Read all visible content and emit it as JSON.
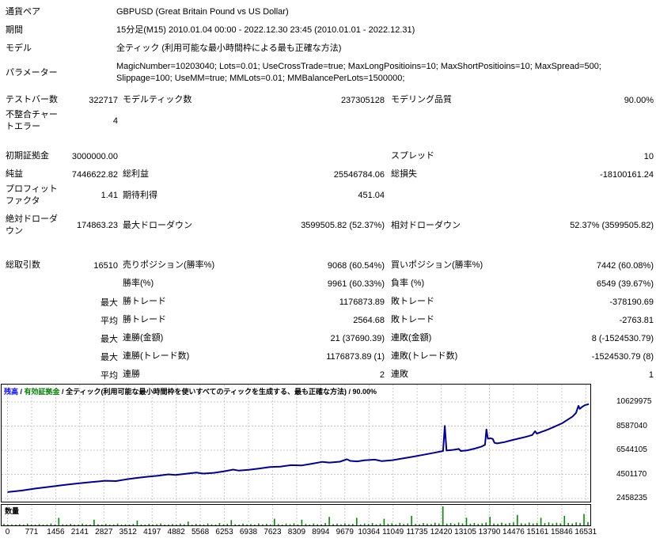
{
  "report": {
    "info_rows": [
      {
        "name": "currency-pair",
        "label": "通貨ペア",
        "value": "GBPUSD (Great Britain Pound vs US Dollar)"
      },
      {
        "name": "period",
        "label": "期間",
        "value": "15分足(M15) 2010.01.04 00:00 - 2022.12.30 23:45 (2010.01.01 - 2022.12.31)"
      },
      {
        "name": "model",
        "label": "モデル",
        "value": "全ティック (利用可能な最小時間枠による最も正確な方法)"
      },
      {
        "name": "parameters",
        "label": "パラメーター",
        "value": "MagicNumber=10203040; Lots=0.01; UseCrossTrade=true; MaxLongPositioins=10; MaxShortPositioins=10; MaxSpread=500; Slippage=100; UseMM=true; MMLots=0.01; MMBalancePerLots=1500000;"
      }
    ],
    "stats_rows": [
      {
        "name": "bars-ticks-quality",
        "gap": "",
        "cells": [
          "テストバー数",
          "322717",
          "モデルティック数",
          "237305128",
          "モデリング品質",
          "90.00%"
        ]
      },
      {
        "name": "mismatched-chart-errors",
        "gap": "",
        "cells": [
          "不整合チャートエラー",
          "4",
          "",
          "",
          "",
          ""
        ]
      },
      {
        "name": "initial-deposit-spread",
        "gap": "lg",
        "cells": [
          "初期証拠金",
          "3000000.00",
          "",
          "",
          "スプレッド",
          "10"
        ]
      },
      {
        "name": "net-profit",
        "gap": "",
        "cells": [
          "純益",
          "7446622.82",
          "総利益",
          "25546784.06",
          "総損失",
          "-18100161.24"
        ]
      },
      {
        "name": "profit-factor",
        "gap": "",
        "cells": [
          "プロフィットファクタ",
          "1.41",
          "期待利得",
          "451.04",
          "",
          ""
        ]
      },
      {
        "name": "drawdown",
        "gap": "sm",
        "cells": [
          "絶対ドローダウン",
          "174863.23",
          "最大ドローダウン",
          "3599505.82 (52.37%)",
          "相対ドローダウン",
          "52.37% (3599505.82)"
        ]
      },
      {
        "name": "total-trades",
        "gap": "md",
        "cells": [
          "総取引数",
          "16510",
          "売りポジション(勝率%)",
          "9068 (60.54%)",
          "買いポジション(勝率%)",
          "7442 (60.08%)"
        ]
      },
      {
        "name": "win-loss-rate",
        "gap": "",
        "cells": [
          "",
          "",
          "勝率(%)",
          "9961 (60.33%)",
          "負率 (%)",
          "6549 (39.67%)"
        ]
      },
      {
        "name": "largest-trades",
        "gap": "",
        "cells": [
          "",
          "最大",
          "勝トレード",
          "1176873.89",
          "敗トレード",
          "-378190.69"
        ]
      },
      {
        "name": "average-trades",
        "gap": "",
        "cells": [
          "",
          "平均",
          "勝トレード",
          "2564.68",
          "敗トレード",
          "-2763.81"
        ]
      },
      {
        "name": "max-consecutive-money",
        "gap": "",
        "cells": [
          "",
          "最大",
          "連勝(金額)",
          "21 (37690.39)",
          "連敗(金額)",
          "8 (-1524530.79)"
        ]
      },
      {
        "name": "max-consecutive-trades",
        "gap": "",
        "cells": [
          "",
          "最大",
          "連勝(トレード数)",
          "1176873.89 (1)",
          "連敗(トレード数)",
          "-1524530.79 (8)"
        ]
      },
      {
        "name": "avg-consecutive",
        "gap": "",
        "cells": [
          "",
          "平均",
          "連勝",
          "2",
          "連敗",
          "1"
        ]
      }
    ]
  },
  "chart_header": {
    "balance_label": "残高",
    "equity_label": "有効証拠金",
    "model_note": "全ティック(利用可能な最小時間枠を使いすべてのティックを生成する、最も正確な方法)",
    "quality": "90.00%",
    "separator": " / "
  },
  "volume_label": "数量",
  "chart_data": {
    "type": "line",
    "title": "残高 / 有効証拠金",
    "x_ticks": [
      0,
      771,
      1456,
      2141,
      2827,
      3512,
      4197,
      4882,
      5568,
      6253,
      6938,
      7623,
      8309,
      8994,
      9679,
      10364,
      11049,
      11735,
      12420,
      13105,
      13790,
      14476,
      15161,
      15846,
      16531
    ],
    "y_ticks": [
      10629975,
      8587040,
      6544105,
      4501170,
      2458235
    ],
    "x_range": [
      0,
      16760
    ],
    "y_range": [
      2458235,
      10629975
    ],
    "grid": true,
    "line_color": "#000096",
    "volume_color": "#008C00",
    "grid_color": "#C8C8C8",
    "balance_label_color": "#0000FF",
    "equity_label_color": "#008000",
    "series": [
      {
        "name": "残高",
        "points": [
          [
            0,
            3000000
          ],
          [
            400,
            3130000
          ],
          [
            800,
            3300000
          ],
          [
            1200,
            3450000
          ],
          [
            1600,
            3600000
          ],
          [
            2000,
            3730000
          ],
          [
            2400,
            3850000
          ],
          [
            2800,
            3960000
          ],
          [
            3100,
            3930000
          ],
          [
            3400,
            4080000
          ],
          [
            3700,
            4200000
          ],
          [
            4000,
            4300000
          ],
          [
            4300,
            4380000
          ],
          [
            4600,
            4500000
          ],
          [
            4800,
            4450000
          ],
          [
            5100,
            4550000
          ],
          [
            5400,
            4650000
          ],
          [
            5600,
            4570000
          ],
          [
            5900,
            4630000
          ],
          [
            6200,
            4760000
          ],
          [
            6450,
            4900000
          ],
          [
            6600,
            4820000
          ],
          [
            6900,
            4880000
          ],
          [
            7200,
            5000000
          ],
          [
            7500,
            5120000
          ],
          [
            7800,
            5160000
          ],
          [
            8100,
            5280000
          ],
          [
            8400,
            5250000
          ],
          [
            8700,
            5400000
          ],
          [
            9000,
            5560000
          ],
          [
            9200,
            5500000
          ],
          [
            9500,
            5570000
          ],
          [
            9700,
            5780000
          ],
          [
            9800,
            5640000
          ],
          [
            10000,
            5600000
          ],
          [
            10200,
            5690000
          ],
          [
            10500,
            5750000
          ],
          [
            10700,
            5620000
          ],
          [
            11000,
            5700000
          ],
          [
            11300,
            5850000
          ],
          [
            11600,
            6000000
          ],
          [
            11900,
            6160000
          ],
          [
            12200,
            6330000
          ],
          [
            12450,
            6480000
          ],
          [
            12500,
            8600000
          ],
          [
            12550,
            6520000
          ],
          [
            12750,
            6580000
          ],
          [
            12900,
            6650000
          ],
          [
            12960,
            6480000
          ],
          [
            13150,
            6540000
          ],
          [
            13350,
            6680000
          ],
          [
            13550,
            6850000
          ],
          [
            13650,
            7000000
          ],
          [
            13690,
            8300000
          ],
          [
            13730,
            7520000
          ],
          [
            13800,
            7560000
          ],
          [
            13870,
            7500000
          ],
          [
            13920,
            7170000
          ],
          [
            14000,
            7120000
          ],
          [
            14200,
            7230000
          ],
          [
            14400,
            7380000
          ],
          [
            14600,
            7520000
          ],
          [
            14800,
            7660000
          ],
          [
            15000,
            7830000
          ],
          [
            15080,
            8150000
          ],
          [
            15130,
            7950000
          ],
          [
            15250,
            8080000
          ],
          [
            15450,
            8300000
          ],
          [
            15650,
            8560000
          ],
          [
            15850,
            8820000
          ],
          [
            16000,
            9100000
          ],
          [
            16150,
            9400000
          ],
          [
            16250,
            9700000
          ],
          [
            16320,
            10300000
          ],
          [
            16360,
            10050000
          ],
          [
            16420,
            10200000
          ],
          [
            16500,
            10350000
          ],
          [
            16620,
            10446623
          ]
        ]
      }
    ],
    "volume_bars": [
      8,
      3,
      5,
      2,
      6,
      3,
      9,
      4,
      2,
      7,
      3,
      5,
      10,
      4,
      40,
      6,
      3,
      8,
      4,
      2,
      9,
      5,
      3,
      30,
      6,
      4,
      8,
      3,
      5,
      9,
      4,
      6,
      2,
      7,
      25,
      5,
      3,
      8,
      4,
      6,
      10,
      3,
      5,
      7,
      4,
      9,
      6,
      20,
      4,
      8,
      5,
      3,
      10,
      6,
      4,
      12,
      5,
      8,
      28,
      6,
      3,
      9,
      5,
      7,
      4,
      10,
      6,
      8,
      5,
      35,
      7,
      4,
      9,
      6,
      11,
      5,
      30,
      8,
      4,
      10,
      6,
      5,
      12,
      45,
      7,
      9,
      5,
      11,
      6,
      8,
      40,
      5,
      10,
      7,
      12,
      6,
      9,
      35,
      8,
      11,
      5,
      13,
      7,
      10,
      50,
      8,
      6,
      12,
      9,
      7,
      14,
      10,
      100,
      9,
      12,
      8,
      15,
      10,
      40,
      9,
      13,
      8,
      11,
      15,
      45,
      10,
      8,
      14,
      9,
      12,
      16,
      55,
      11,
      9,
      15,
      10,
      13,
      40,
      12,
      16,
      10,
      14,
      11,
      50,
      13,
      10,
      16,
      12,
      60,
      18
    ]
  }
}
